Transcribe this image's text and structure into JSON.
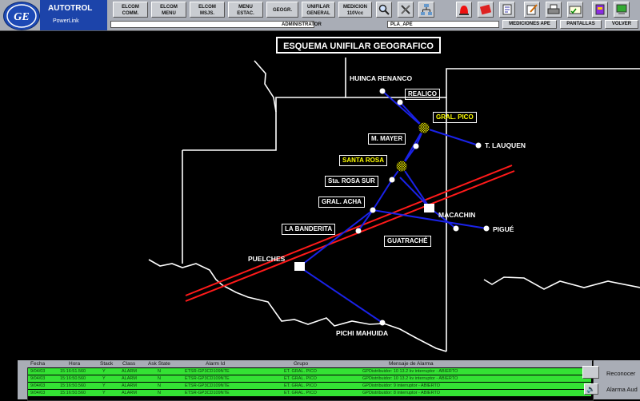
{
  "header": {
    "brand": "AUTOTROL",
    "product": "PowerLink",
    "nav_buttons": [
      "ELCOM\nCOMM.",
      "ELCOM\nMENU",
      "ELCOM\nMSJS.",
      "MENU\nESTAC.",
      "GEOGR.",
      "UNIFILAR\nGENERAL",
      "MEDICION\n110Vcc"
    ],
    "icons": [
      "magnifier-icon",
      "tools-icon",
      "network-icon",
      "alarm-light-icon",
      "log-book-icon",
      "notepad-icon",
      "edit-icon",
      "printer-icon",
      "cheque-icon",
      "book-icon",
      "print-screen-icon"
    ],
    "user_field": "ADMINISTRATOR",
    "station_field": "PLA_APE",
    "buttons": {
      "mediciones": "MEDICIONES APE",
      "pantallas": "PANTALLAS",
      "volver": "VOLVER"
    }
  },
  "map": {
    "title": "ESQUEMA UNIFILAR GEOGRAFICO",
    "stations": {
      "huinca": "HUINCA RENANCO",
      "realico": "REALICO",
      "gral_pico": "GRAL. PICO",
      "m_mayer": "M. MAYER",
      "t_lauquen": "T. LAUQUEN",
      "santa_rosa": "SANTA ROSA",
      "sta_rosa_sur": "Sta. ROSA SUR",
      "gral_acha": "GRAL. ACHA",
      "macachin": "MACACHIN",
      "la_banderita": "LA BANDERITA",
      "pigue": "PIGUÉ",
      "guatrache": "GUATRACHÉ",
      "puelches": "PUELCHES",
      "pichi": "PICHI MAHUIDA"
    },
    "colors": {
      "line_blue": "#1a22e8",
      "line_red": "#ff1a1a",
      "highlight": "#ffff00"
    }
  },
  "alarms": {
    "columns": [
      "Fecha",
      "Hora",
      "Stack",
      "Class",
      "Ask State",
      "Alarm Id",
      "Grupo",
      "Mensaje de Alarma"
    ],
    "rows": [
      {
        "fecha": "9/04/03",
        "hora": "15:16:51.560",
        "stack": "Y",
        "clase": "ALARM",
        "ask": "N",
        "id": "ETSR-GP3CD109NTE",
        "grupo": "ET. GRAL. PICO",
        "mensaje": "GPDistribuidor: 10 13.2 kv interruptor - ABIERTO"
      },
      {
        "fecha": "9/04/03",
        "hora": "15:16:50.560",
        "stack": "Y",
        "clase": "ALARM",
        "ask": "N",
        "id": "ETSR-GP3CD109NTE",
        "grupo": "ET. GRAL. PICO",
        "mensaje": "GPDistribuidor: 10 13.2 kv interruptor - ABIERTO"
      },
      {
        "fecha": "9/04/03",
        "hora": "15:16:50.560",
        "stack": "Y",
        "clase": "ALARM",
        "ask": "N",
        "id": "ETSR-GP3CD109NTE",
        "grupo": "ET. GRAL. PICO",
        "mensaje": "GPDistribuidor: 9 interruptor - ABIERTO"
      },
      {
        "fecha": "9/04/03",
        "hora": "15:16:50.560",
        "stack": "Y",
        "clase": "ALARM",
        "ask": "N",
        "id": "ETSR-GP3CD109NTE",
        "grupo": "ET. GRAL. PICO",
        "mensaje": "GPDistribuidor: 8 interruptor - ABIERTO"
      }
    ],
    "ack_label": "Reconocer",
    "sound_label": "Alarma Aud"
  }
}
